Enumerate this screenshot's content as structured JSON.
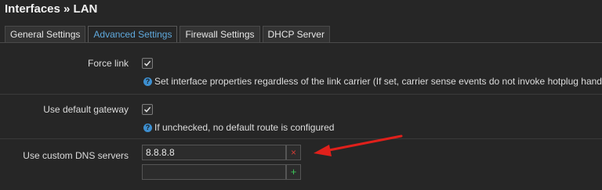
{
  "page": {
    "title": "Interfaces » LAN"
  },
  "tabs": [
    {
      "label": "General Settings",
      "active": false
    },
    {
      "label": "Advanced Settings",
      "active": true
    },
    {
      "label": "Firewall Settings",
      "active": false
    },
    {
      "label": "DHCP Server",
      "active": false
    }
  ],
  "fields": {
    "force_link": {
      "label": "Force link",
      "checked": true,
      "help": "Set interface properties regardless of the link carrier (If set, carrier sense events do not invoke hotplug handlers)."
    },
    "default_gateway": {
      "label": "Use default gateway",
      "checked": true,
      "help": "If unchecked, no default route is configured"
    },
    "custom_dns": {
      "label": "Use custom DNS servers",
      "entries": [
        "8.8.8.8"
      ],
      "new_entry_value": "",
      "remove_symbol": "×",
      "add_symbol": "+"
    }
  },
  "icons": {
    "help": "question-circle-icon",
    "check": "checkmark-icon"
  },
  "colors": {
    "background": "#262626",
    "active_tab_text": "#5fa9dd",
    "help_icon": "#3d8fd0",
    "remove_button": "#cf3b35",
    "add_button": "#3ec95a",
    "annotation_arrow": "#e0201b"
  }
}
